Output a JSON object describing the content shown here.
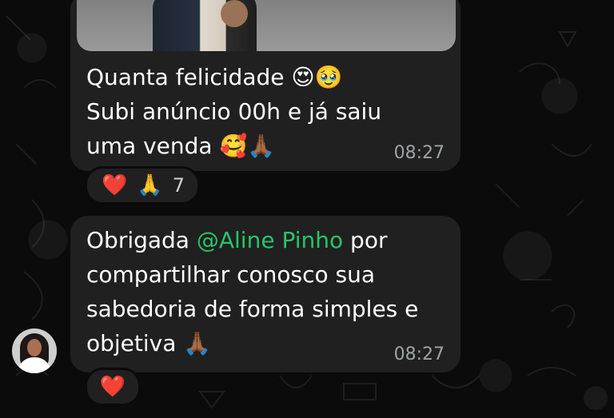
{
  "messages": [
    {
      "lines": [
        "Quanta felicidade 😍🥹",
        "Subi anúncio 00h e já saiu",
        "uma venda 🥰🙏🏾"
      ],
      "time": "08:27",
      "reactions": {
        "emojis": [
          "❤️",
          "🙏"
        ],
        "count": "7"
      }
    },
    {
      "prefix": "Obrigada ",
      "mention": "@Aline Pinho",
      "rest_line_1": " por",
      "lines": [
        "compartilhar conosco sua",
        "sabedoria de forma simples e",
        "objetiva 🙏🏾"
      ],
      "time": "08:27",
      "reactions": {
        "emojis": [
          "❤️"
        ]
      }
    }
  ],
  "colors": {
    "background": "#0b0b0b",
    "bubble": "#202020",
    "mention": "#27c469",
    "timestamp": "#9ea3a5"
  },
  "icons": {
    "photo": "image",
    "avatar": "profile-photo",
    "wallpaper": "doodle-pattern"
  }
}
